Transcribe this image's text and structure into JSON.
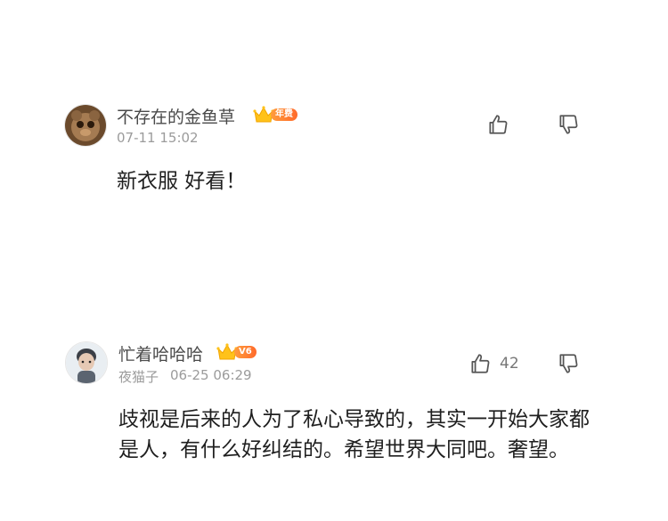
{
  "comments": [
    {
      "username": "不存在的金鱼草",
      "badge": "年费",
      "meta": "07-11 15:02",
      "content": "新衣服 好看！",
      "like_count": ""
    },
    {
      "username": "忙着哈哈哈",
      "badge": "V6",
      "meta_left": "夜猫子",
      "meta_right": "06-25 06:29",
      "content": "歧视是后来的人为了私心导致的，其实一开始大家都是人，有什么好纠结的。希望世界大同吧。奢望。",
      "like_count": "42"
    }
  ],
  "icons": {
    "like": "thumb-up-icon",
    "dislike": "thumb-down-icon",
    "vip": "crown-icon"
  },
  "colors": {
    "badge_gradient_start": "#ff9d3c",
    "badge_gradient_end": "#ff6a2b",
    "crown": "#ffc21a"
  }
}
